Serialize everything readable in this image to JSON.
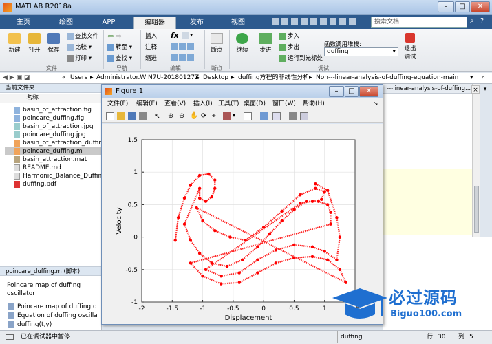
{
  "window": {
    "title": "MATLAB R2018a"
  },
  "tabs": [
    "主页",
    "绘图",
    "APP",
    "编辑器",
    "发布",
    "视图"
  ],
  "search_placeholder": "搜索文档",
  "ribbon": {
    "file": {
      "new": "新建",
      "open": "打开",
      "save": "保存",
      "find_file": "查找文件",
      "compare": "比较",
      "print": "打印",
      "group": "文件"
    },
    "nav": {
      "goto": "转至",
      "find": "查找",
      "group": "导航"
    },
    "edit": {
      "insert": "插入",
      "comment": "注释",
      "indent": "缩进",
      "fx": "fx",
      "group": "编辑"
    },
    "breakpoints": {
      "label": "断点",
      "group": "断点"
    },
    "debug": {
      "continue": "继续",
      "step": "步进",
      "step_in": "步入",
      "step_out": "步出",
      "run_to_cursor": "运行到光标处",
      "func_label": "函数调用堆栈:",
      "func_value": "duffing",
      "quit": "退出\n调试",
      "group": "调试"
    }
  },
  "path": [
    "Users",
    "Administrator.WIN7U-20180127Z",
    "Desktop",
    "duffing方程的非线性分析",
    "Non---linear-analysis-of-duffing-equation-main"
  ],
  "current_folder": {
    "header": "当前文件夹",
    "col_name": "名称",
    "files": [
      "basin_of_attraction.fig",
      "poincare_duffing.fig",
      "basin_of_attraction.jpg",
      "poincare_duffing.jpg",
      "basin_of_attraction_duffing.",
      "poincare_duffing.m",
      "basin_attraction.mat",
      "README.md",
      "Harmonic_Balance_Duffing.",
      "duffing.pdf"
    ]
  },
  "details": {
    "header": "poincare_duffing.m (脚本)",
    "description": "Poincare map of duffing oscillator",
    "items": [
      "Poincare map of duffing o",
      "Equation of duffing oscilla",
      "duffing(t,y)"
    ]
  },
  "editor_tab_text": "---linear-analysis-of-duffing...",
  "status": {
    "text": "已在调试器中暂停",
    "func": "duffing",
    "row_label": "行",
    "row": "30",
    "col_label": "列",
    "col": "5"
  },
  "figure": {
    "title": "Figure 1",
    "menu": [
      "文件(F)",
      "编辑(E)",
      "查看(V)",
      "插入(I)",
      "工具(T)",
      "桌面(D)",
      "窗口(W)",
      "帮助(H)"
    ]
  },
  "logo": {
    "cn": "必过源码",
    "en": "Biguo100.com"
  },
  "colors": {
    "plot": "#ff0000",
    "tab_bar": "#2d5a8e"
  },
  "chart_data": {
    "type": "scatter",
    "title": "",
    "xlabel": "Displacement",
    "ylabel": "Velocity",
    "xlim": [
      -2,
      1.5
    ],
    "ylim": [
      -1,
      1.5
    ],
    "xticks": [
      "-2",
      "-1.5",
      "-1",
      "-0.5",
      "0",
      "0.5",
      "1",
      "1.5"
    ],
    "yticks": [
      "-1",
      "-0.5",
      "0",
      "0.5",
      "1",
      "1.5"
    ],
    "grid": true,
    "series": [
      {
        "color": "#ff0000",
        "points": [
          [
            -1.45,
            -0.05
          ],
          [
            -1.4,
            0.3
          ],
          [
            -1.3,
            0.6
          ],
          [
            -1.2,
            0.8
          ],
          [
            -1.05,
            0.95
          ],
          [
            -0.9,
            0.97
          ],
          [
            -0.8,
            0.88
          ],
          [
            -0.8,
            0.75
          ],
          [
            -0.85,
            0.62
          ],
          [
            -0.95,
            0.55
          ],
          [
            -1.05,
            0.6
          ],
          [
            -1.05,
            0.75
          ],
          [
            -1.3,
            0.2
          ],
          [
            -1.2,
            -0.05
          ],
          [
            -1.05,
            -0.25
          ],
          [
            -0.85,
            -0.4
          ],
          [
            -0.6,
            -0.45
          ],
          [
            -0.35,
            -0.35
          ],
          [
            -0.1,
            -0.15
          ],
          [
            0.1,
            0.05
          ],
          [
            0.3,
            0.25
          ],
          [
            0.5,
            0.42
          ],
          [
            0.7,
            0.55
          ],
          [
            0.9,
            0.55
          ],
          [
            1.05,
            0.5
          ],
          [
            1.1,
            0.38
          ],
          [
            1.1,
            0.2
          ],
          [
            -1.2,
            -0.4
          ],
          [
            -1.0,
            -0.6
          ],
          [
            -0.7,
            -0.72
          ],
          [
            -0.4,
            -0.7
          ],
          [
            -0.1,
            -0.55
          ],
          [
            0.2,
            -0.4
          ],
          [
            0.5,
            -0.32
          ],
          [
            0.8,
            -0.3
          ],
          [
            1.05,
            -0.35
          ],
          [
            1.25,
            -0.5
          ],
          [
            1.35,
            -0.7
          ],
          [
            -1.1,
            0.45
          ],
          [
            -1.0,
            0.25
          ],
          [
            -0.8,
            0.1
          ],
          [
            -0.55,
            0.0
          ],
          [
            -0.3,
            -0.05
          ],
          [
            0.0,
            0.15
          ],
          [
            0.3,
            0.4
          ],
          [
            0.6,
            0.65
          ],
          [
            0.85,
            0.75
          ],
          [
            1.0,
            0.7
          ],
          [
            0.95,
            0.58
          ],
          [
            0.8,
            0.55
          ],
          [
            0.6,
            0.52
          ],
          [
            -0.95,
            -0.5
          ],
          [
            -0.7,
            -0.6
          ],
          [
            -0.4,
            -0.55
          ],
          [
            -0.1,
            -0.35
          ],
          [
            0.2,
            -0.2
          ],
          [
            0.5,
            -0.12
          ],
          [
            0.8,
            -0.15
          ],
          [
            1.0,
            -0.22
          ],
          [
            1.2,
            -0.35
          ],
          [
            1.25,
            0.0
          ],
          [
            1.2,
            0.3
          ],
          [
            1.05,
            0.72
          ],
          [
            0.85,
            0.82
          ]
        ]
      }
    ]
  }
}
